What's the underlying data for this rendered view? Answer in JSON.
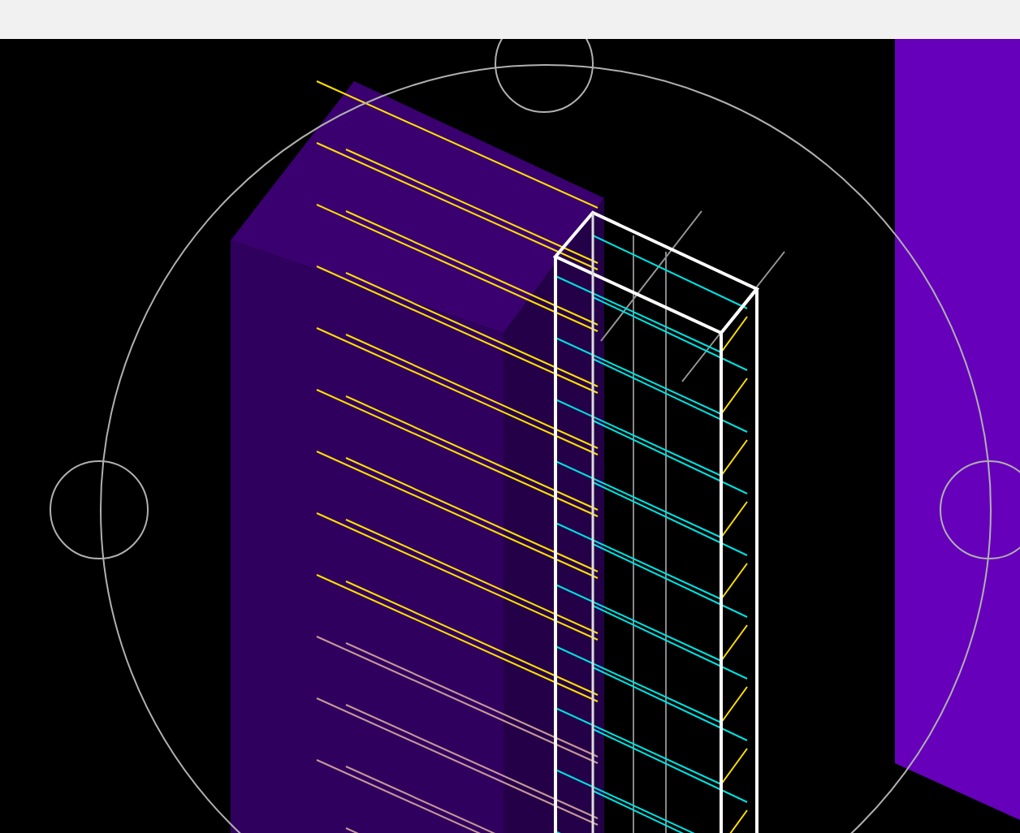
{
  "viewport": {
    "kind": "shaded"
  }
}
